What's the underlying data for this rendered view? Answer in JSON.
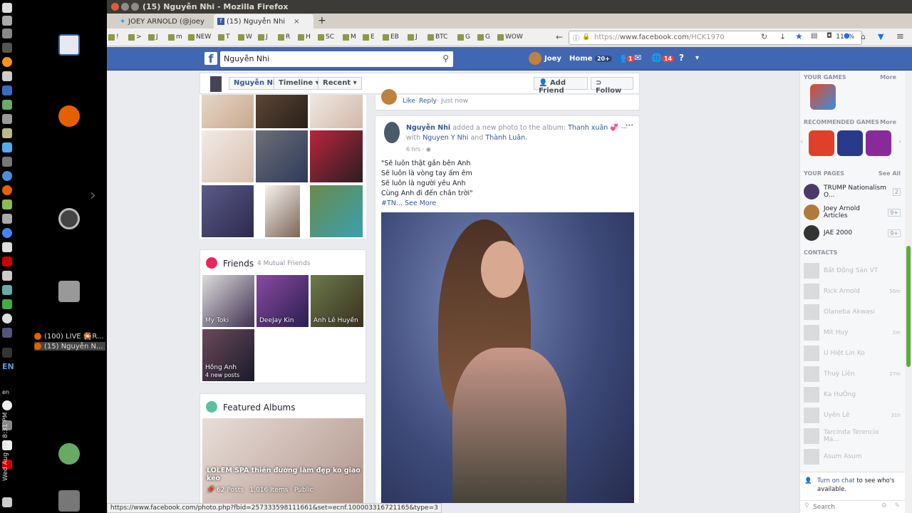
{
  "desktop": {
    "clock": "Wed Aug 30, 8:31 PM",
    "lang_indicator": "EN",
    "lang_small": "en",
    "window_list": [
      "(100) LIVE 🎇R...",
      "(15) Nguyễn N..."
    ]
  },
  "browser": {
    "window_title": "(15) Nguyễn Nhi - Mozilla Firefox",
    "tabs": [
      {
        "label": "JOEY ARNOLD (@joey"
      },
      {
        "label": "(15) Nguyễn Nhi"
      }
    ],
    "new_tab": "+",
    "bookmarks": [
      "!",
      ">",
      "J",
      "m",
      "NEW",
      "T",
      "W",
      "J",
      "R",
      "H",
      "SC",
      "M",
      "E",
      "EB",
      "J",
      "BTC",
      "G",
      "G",
      "WOW"
    ],
    "url_scheme": "https://",
    "url_host": "www.facebook.com",
    "url_rest": "/HCK1970",
    "zoom": "110%",
    "status_url": "https://www.facebook.com/photo.php?fbid=257333598111661&set=ecnf.100003316721165&type=3"
  },
  "fb": {
    "logo": "f",
    "search_value": "Nguyễn Nhi",
    "user_name": "Joey",
    "home_label": "Home",
    "home_count": "20+",
    "friends_badge": "1",
    "notif_badge": "14",
    "profile": {
      "name": "Nguyễn Nhi",
      "timeline": "Timeline",
      "recent": "Recent",
      "add_friend": "Add Friend",
      "follow": "Follow"
    },
    "comment_actions": {
      "like": "Like",
      "reply": "Reply",
      "time": "Just now"
    },
    "friends_card": {
      "title": "Friends",
      "mutual": "4 Mutual Friends",
      "tiles": [
        {
          "name": "My Toki",
          "sub": ""
        },
        {
          "name": "DeeJay Kin",
          "sub": ""
        },
        {
          "name": "Anh Lê Huyền",
          "sub": ""
        },
        {
          "name": "Hồng Anh",
          "sub": "4 new posts"
        }
      ]
    },
    "albums_card": {
      "title": "Featured Albums",
      "album_title": "LOLEM SPA thiên đường làm đẹp ko giao kéo",
      "album_meta": "62 Posts · 1,016 Items · Public"
    },
    "post": {
      "author": "Nguyễn Nhi",
      "action": "added a new photo to the album:",
      "album": "Thanh xuân 💞",
      "with": "— with",
      "tag1": "Nguyen Y Nhi",
      "and": "and",
      "tag2": "Thành Luân.",
      "time": "6 hrs",
      "lines": [
        "\"Sẽ luôn thật gần bên Anh",
        "Sẽ luôn là vòng tay ấm êm",
        "Sẽ luôn là người yêu Anh",
        "Cùng Anh đi đến chân trời\""
      ],
      "hashtag": "#TN...",
      "see_more": "See More",
      "menu": "···"
    },
    "right": {
      "your_games": "Your Games",
      "more1": "More",
      "recommended": "Recommended Games",
      "more2": "More",
      "your_pages": "Your Pages",
      "see_all": "See All",
      "pages": [
        {
          "name": "TRUMP Nationalism O...",
          "count": "2"
        },
        {
          "name": "Joey Arnold Articles",
          "count": "9+"
        },
        {
          "name": "JAE 2000",
          "count": "9+"
        }
      ],
      "contacts_title": "Contacts",
      "contacts": [
        {
          "name": "Bất Động Sản VT",
          "time": ""
        },
        {
          "name": "Rick Arnold",
          "time": "56m"
        },
        {
          "name": "Olaneba Akwasi",
          "time": ""
        },
        {
          "name": "Mít Huy",
          "time": "2m"
        },
        {
          "name": "U Hiệt Lin Ko",
          "time": ""
        },
        {
          "name": "Thuỳ Liên",
          "time": "27m"
        },
        {
          "name": "Ka HưÖng",
          "time": ""
        },
        {
          "name": "Uyên Lê",
          "time": "31h"
        },
        {
          "name": "Tarcinda Terencio Ma...",
          "time": ""
        },
        {
          "name": "Asum Asum",
          "time": ""
        }
      ],
      "chat_notice_link": "Turn on chat",
      "chat_notice_rest": "to see who's available.",
      "search_placeholder": "Search"
    }
  }
}
